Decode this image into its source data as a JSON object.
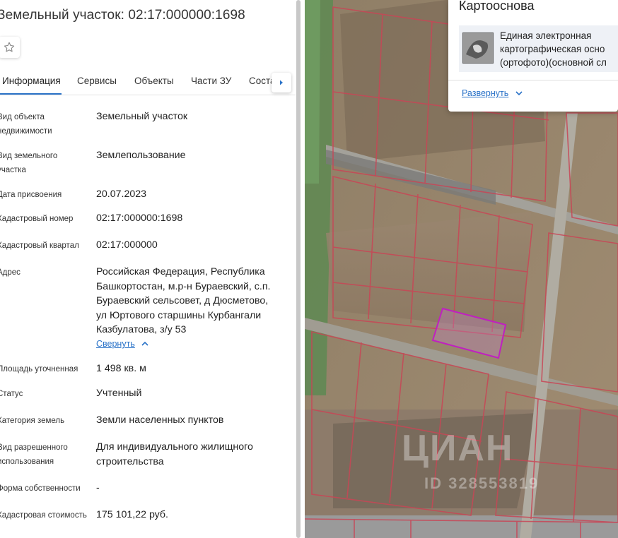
{
  "panel": {
    "title": "Земельный участок: 02:17:000000:1698",
    "star_icon": "star-outline-icon"
  },
  "tabs": [
    {
      "label": "Информация",
      "active": true
    },
    {
      "label": "Сервисы",
      "active": false
    },
    {
      "label": "Объекты",
      "active": false
    },
    {
      "label": "Части ЗУ",
      "active": false
    },
    {
      "label": "Состав",
      "active": false
    }
  ],
  "tabs_next_icon": "chevron-right-icon",
  "rows": [
    {
      "label": "Вид объекта недвижимости",
      "value": "Земельный участок"
    },
    {
      "label": "Вид земельного участка",
      "value": "Землепользование"
    },
    {
      "label": "Дата присвоения",
      "value": "20.07.2023"
    },
    {
      "label": "Кадастровый номер",
      "value": "02:17:000000:1698"
    },
    {
      "label": "Кадастровый квартал",
      "value": "02:17:000000"
    },
    {
      "label": "Адрес",
      "value": "Российская Федерация, Республика Башкортостан, м.р-н Бураевский, с.п. Бураевский сельсовет, д Дюсметово, ул Юртового старшины Курбангали Казбулатова, з/у 53"
    },
    {
      "label": "Площадь уточненная",
      "value": "1 498 кв. м"
    },
    {
      "label": "Статус",
      "value": "Учтенный"
    },
    {
      "label": "Категория земель",
      "value": "Земли населенных пунктов"
    },
    {
      "label": "Вид разрешенного использования",
      "value": "Для индивидуального жилищного строительства"
    },
    {
      "label": "Форма собственности",
      "value": "-"
    },
    {
      "label": "Кадастровая стоимость",
      "value": "175 101,22 руб."
    }
  ],
  "collapse_link": "Свернуть",
  "basemap": {
    "title": "Картооснова",
    "layer_text_line1": "Единая электронная",
    "layer_text_line2": "картографическая осно",
    "layer_text_line3": "(ортофото)(основной сл",
    "expand_link": "Развернуть"
  },
  "watermark": {
    "brand": "ЦИАН",
    "id": "ID 328553819"
  },
  "colors": {
    "accent": "#2b73c8",
    "parcel_highlight": "#c020c0",
    "parcel_border": "#d04050"
  }
}
